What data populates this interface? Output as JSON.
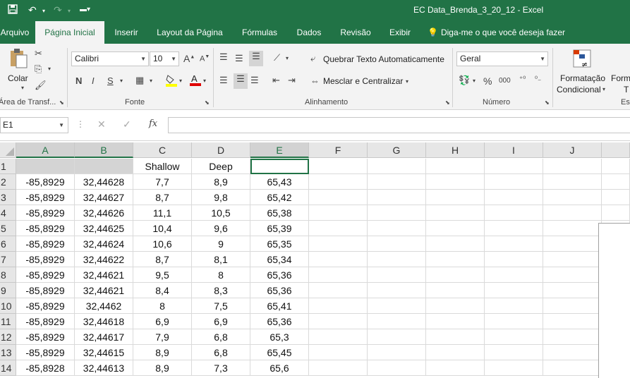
{
  "window": {
    "title": "EC Data_Brenda_3_20_12  -  Excel"
  },
  "quick_access": {
    "save_icon": "save-icon",
    "undo_icon": "undo-icon",
    "redo_icon": "redo-icon",
    "customize_icon": "customize-icon"
  },
  "tabs": [
    {
      "label": "Arquivo"
    },
    {
      "label": "Página Inicial"
    },
    {
      "label": "Inserir"
    },
    {
      "label": "Layout da Página"
    },
    {
      "label": "Fórmulas"
    },
    {
      "label": "Dados"
    },
    {
      "label": "Revisão"
    },
    {
      "label": "Exibir"
    },
    {
      "label": "Diga-me o que você deseja fazer"
    }
  ],
  "ribbon": {
    "clipboard": {
      "paste_label": "Colar",
      "group_label": "Área de Transf..."
    },
    "font": {
      "font_name": "Calibri",
      "font_size": "10",
      "bold": "N",
      "italic": "I",
      "underline": "S",
      "group_label": "Fonte"
    },
    "alignment": {
      "wrap_text": "Quebrar Texto Automaticamente",
      "merge_center": "Mesclar e Centralizar",
      "group_label": "Alinhamento"
    },
    "number": {
      "format": "Geral",
      "percent": "%",
      "thousands": "000",
      "group_label": "Número"
    },
    "styles": {
      "conditional_1": "Formatação",
      "conditional_2": "Condicional",
      "format_1": "Form",
      "format_2": "T",
      "group_label_partial": "Es"
    }
  },
  "formula_bar": {
    "name_box": "E1",
    "fx": "fx",
    "value": ""
  },
  "sheet": {
    "columns": [
      "A",
      "B",
      "C",
      "D",
      "E",
      "F",
      "G",
      "H",
      "I",
      "J"
    ],
    "rows": [
      {
        "n": "1",
        "a": "",
        "b": "",
        "c": "Shallow",
        "d": "Deep",
        "e": ""
      },
      {
        "n": "2",
        "a": "-85,8929",
        "b": "32,44628",
        "c": "7,7",
        "d": "8,9",
        "e": "65,43"
      },
      {
        "n": "3",
        "a": "-85,8929",
        "b": "32,44627",
        "c": "8,7",
        "d": "9,8",
        "e": "65,42"
      },
      {
        "n": "4",
        "a": "-85,8929",
        "b": "32,44626",
        "c": "11,1",
        "d": "10,5",
        "e": "65,38"
      },
      {
        "n": "5",
        "a": "-85,8929",
        "b": "32,44625",
        "c": "10,4",
        "d": "9,6",
        "e": "65,39"
      },
      {
        "n": "6",
        "a": "-85,8929",
        "b": "32,44624",
        "c": "10,6",
        "d": "9",
        "e": "65,35"
      },
      {
        "n": "7",
        "a": "-85,8929",
        "b": "32,44622",
        "c": "8,7",
        "d": "8,1",
        "e": "65,34"
      },
      {
        "n": "8",
        "a": "-85,8929",
        "b": "32,44621",
        "c": "9,5",
        "d": "8",
        "e": "65,36"
      },
      {
        "n": "9",
        "a": "-85,8929",
        "b": "32,44621",
        "c": "8,4",
        "d": "8,3",
        "e": "65,36"
      },
      {
        "n": "10",
        "a": "-85,8929",
        "b": "32,4462",
        "c": "8",
        "d": "7,5",
        "e": "65,41"
      },
      {
        "n": "11",
        "a": "-85,8929",
        "b": "32,44618",
        "c": "6,9",
        "d": "6,9",
        "e": "65,36"
      },
      {
        "n": "12",
        "a": "-85,8929",
        "b": "32,44617",
        "c": "7,9",
        "d": "6,8",
        "e": "65,3"
      },
      {
        "n": "13",
        "a": "-85,8929",
        "b": "32,44615",
        "c": "8,9",
        "d": "6,8",
        "e": "65,45"
      },
      {
        "n": "14",
        "a": "-85,8928",
        "b": "32,44613",
        "c": "8,9",
        "d": "7,3",
        "e": "65,6"
      }
    ]
  },
  "colors": {
    "excel_green": "#217346",
    "ribbon_bg": "#f3f3f3",
    "header_bg": "#e6e6e6"
  }
}
